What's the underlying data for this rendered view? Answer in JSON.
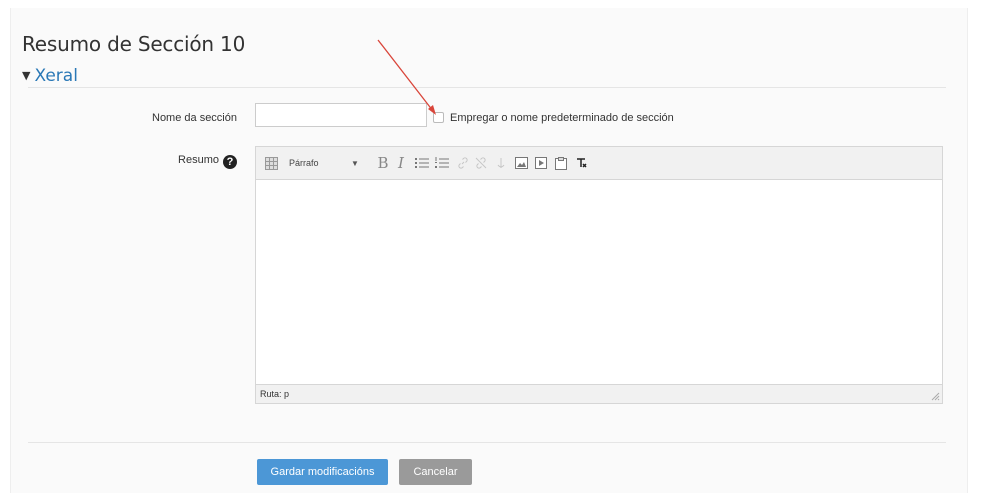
{
  "page": {
    "title": "Resumo de Sección 10",
    "legend": "Xeral"
  },
  "form": {
    "name_label": "Nome da sección",
    "name_value": "",
    "default_checkbox_label": "Empregar o nome predeterminado de sección",
    "default_checkbox_checked": false,
    "summary_label": "Resumo",
    "help_symbol": "?"
  },
  "editor": {
    "format_value": "Párrafo",
    "bold_label": "B",
    "italic_label": "I",
    "status_path": "Ruta: p",
    "content": "",
    "toolbar_icons": [
      "grid-icon",
      "bold-icon",
      "italic-icon",
      "unordered-list-icon",
      "ordered-list-icon",
      "link-icon",
      "unlink-icon",
      "anchor-icon",
      "image-icon",
      "media-icon",
      "paste-icon",
      "clear-format-icon"
    ]
  },
  "actions": {
    "save_label": "Gardar modificacións",
    "cancel_label": "Cancelar"
  },
  "colors": {
    "accent_link": "#2a78b6",
    "save_button": "#4c97d6",
    "cancel_button": "#9a9a9a",
    "annotation_arrow": "#d9453a"
  }
}
